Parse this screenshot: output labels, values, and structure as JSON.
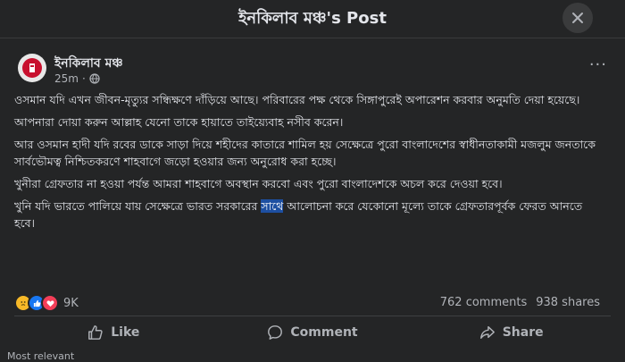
{
  "header": {
    "title": "ইনকিলাব মঞ্চ's Post",
    "close_icon": "close-icon"
  },
  "post": {
    "author": "ইনকিলাব মঞ্চ",
    "time": "25m",
    "visibility_icon": "globe-icon",
    "paragraphs": [
      "ওসমান যদি এখন জীবন-মৃত্যুর সন্ধিক্ষণে দাঁড়িয়ে আছে। পরিবারের পক্ষ থেকে সিঙ্গাপুরেই অপারেশন করবার অনুমতি দেয়া হয়েছে।",
      "আপনারা দোয়া করুন আল্লাহ যেনো তাকে হায়াতে তাইয়্যেবাহ নসীব করেন।",
      "আর ওসমান হাদী যদি রবের ডাকে সাড়া দিয়ে শহীদের কাতারে শামিল হয় সেক্ষেত্রে পুরো বাংলাদেশের স্বাধীনতাকামী মজলুম জনতাকে সার্বভৌমত্ব নিশ্চিতকরণে শাহবাগে জড়ো হওয়ার জন্য অনুরোধ করা হচ্ছে।",
      "খুনীরা গ্রেফতার না হওয়া পর্যন্ত আমরা শাহবাগে অবস্থান করবো এবং পুরো বাংলাদেশকে অচল করে দেওয়া হবে।"
    ],
    "last_paragraph_before": "খুনি যদি ভারতে পালিয়ে যায় সেক্ষেত্রে ভারত সরকারের ",
    "last_paragraph_highlight": "সাথে",
    "last_paragraph_after": " আলোচনা করে যেকোনো মূল্যে তাকে গ্রেফতারপূর্বক ফেরত আনতে হবে।"
  },
  "reactions": {
    "count": "9K",
    "icons": [
      "sad-icon",
      "like-icon",
      "love-icon"
    ]
  },
  "stats": {
    "comments": "762 comments",
    "shares": "938 shares"
  },
  "actions": {
    "like": "Like",
    "comment": "Comment",
    "share": "Share"
  },
  "footer_hint": "Most relevant"
}
